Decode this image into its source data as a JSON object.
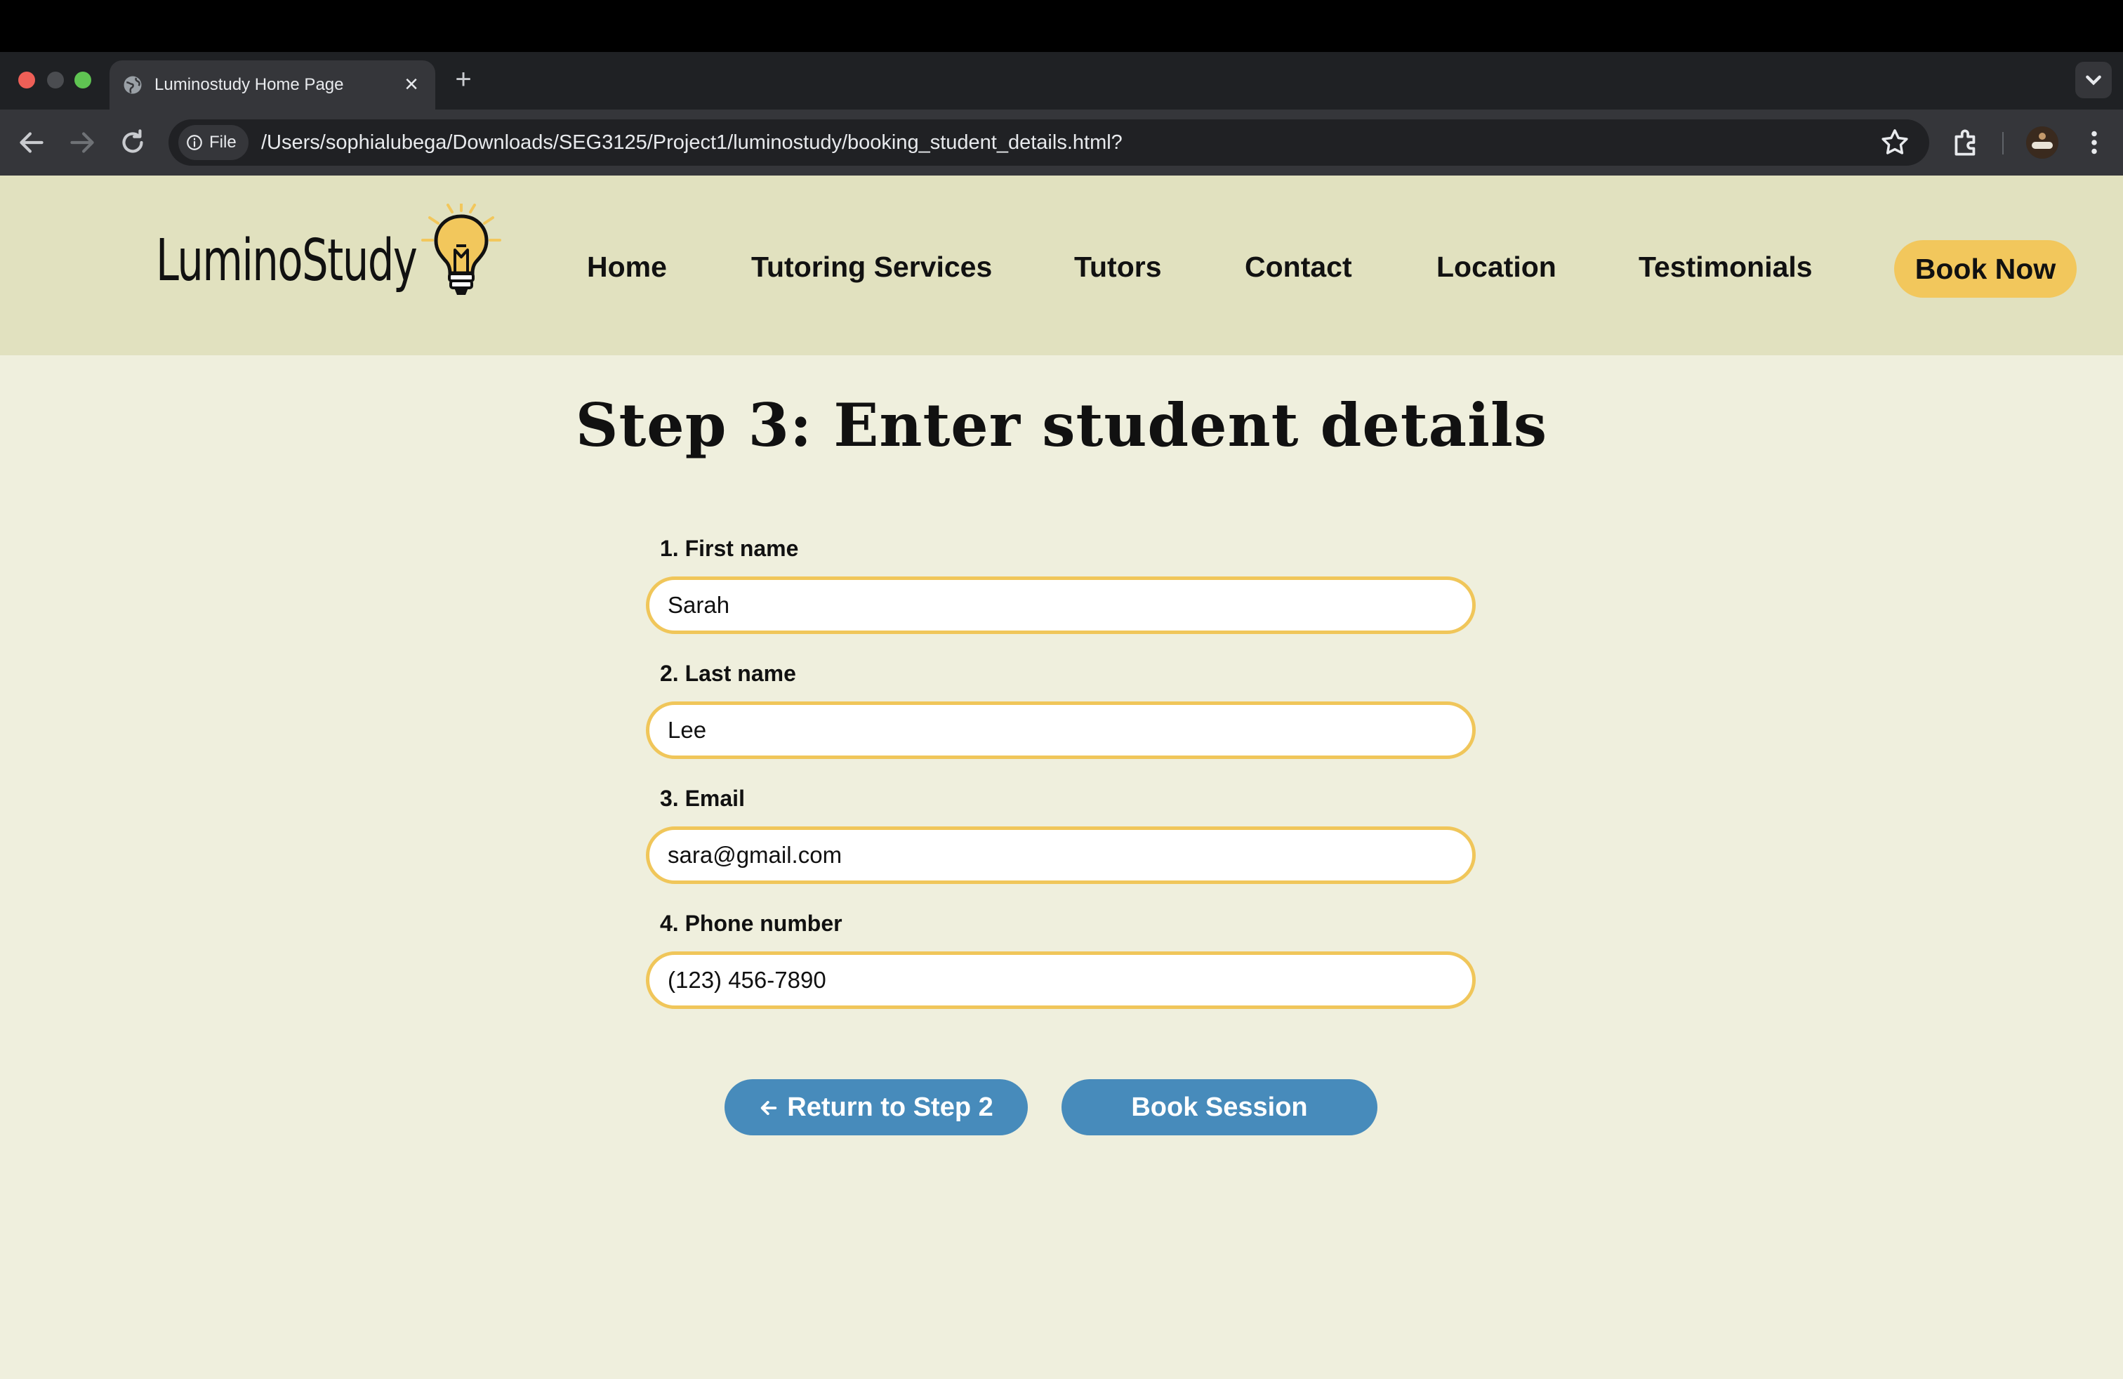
{
  "browser": {
    "tab_title": "Luminostudy Home Page",
    "tab_close": "×",
    "new_tab": "+",
    "site_info_label": "File",
    "url": "/Users/sophialubega/Downloads/SEG3125/Project1/luminostudy/booking_student_details.html?"
  },
  "site": {
    "logo_text": "LuminoStudy",
    "nav": {
      "home": "Home",
      "tutoring_services": "Tutoring Services",
      "tutors": "Tutors",
      "contact": "Contact",
      "location": "Location",
      "testimonials": "Testimonials"
    },
    "book_now": "Book Now"
  },
  "form": {
    "title": "Step 3: Enter student details",
    "fields": [
      {
        "label": "1. First name",
        "value": "Sarah"
      },
      {
        "label": "2. Last name",
        "value": "Lee"
      },
      {
        "label": "3. Email",
        "value": "sara@gmail.com"
      },
      {
        "label": "4. Phone number",
        "value": "(123) 456-7890"
      }
    ],
    "return_label": "Return to Step 2",
    "submit_label": "Book Session"
  },
  "colors": {
    "header_bg": "#e1e1bf",
    "page_bg": "#efefdd",
    "accent_yellow": "#f2c75c",
    "input_border": "#f0c65a",
    "button_blue": "#478bbb"
  },
  "icons": [
    "globe-icon",
    "close-icon",
    "plus-icon",
    "chevron-down-icon",
    "back-arrow-icon",
    "forward-arrow-icon",
    "reload-icon",
    "info-icon",
    "star-icon",
    "puzzle-icon",
    "kebab-menu-icon",
    "lightbulb-icon",
    "arrow-left-icon"
  ]
}
